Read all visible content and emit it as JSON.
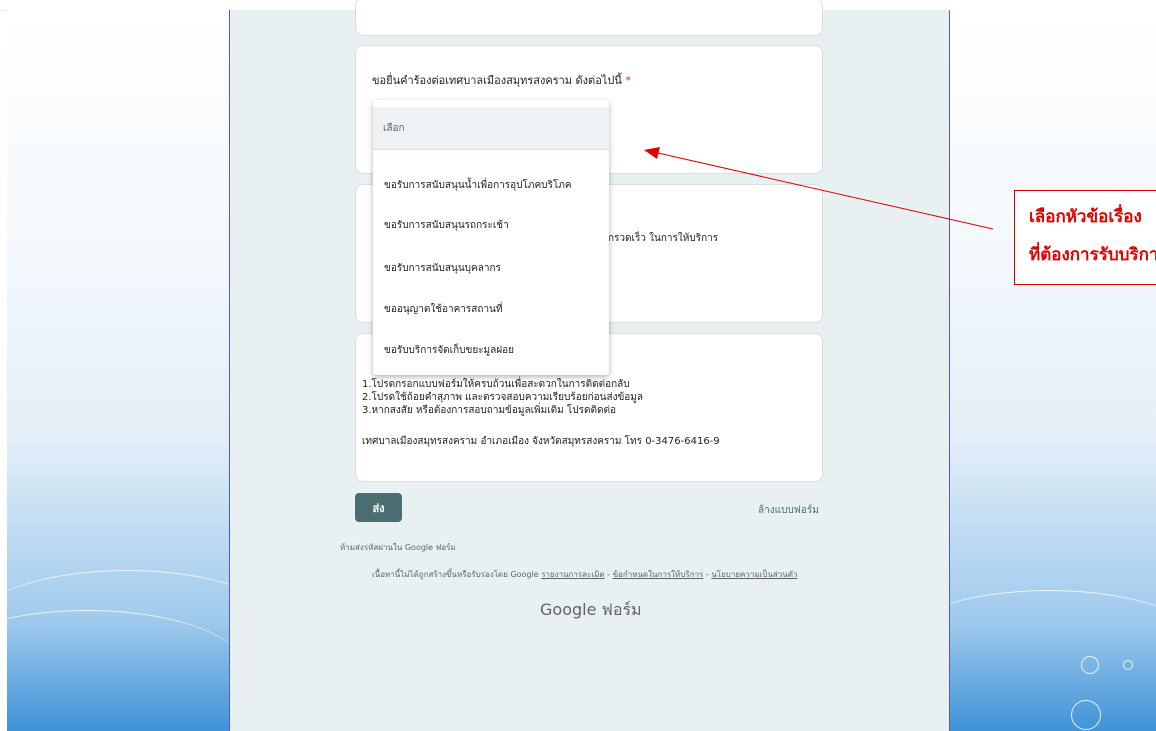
{
  "form": {
    "question_title": "ขอยื่นคำร้องต่อเทศบาลเมืองสมุทรสงคราม ดังต่อไปนี้",
    "required_mark": "*",
    "partial_description": "กรวดเร็ว ในการให้บริการ",
    "info_lines": [
      "1.โปรดกรอกแบบฟอร์มให้ครบถ้วนเพื่อสะดวกในการติดต่อกลับ",
      "2.โปรดใช้ถ้อยคำสุภาพ และตรวจสอบความเรียบร้อยก่อนส่งข้อมูล",
      "3.หากสงสัย หรือต้องการสอบถามข้อมูลเพิ่มเติม โปรดติดต่อ"
    ],
    "contact": "เทศบาลเมืองสมุทรสงคราม อำเภอเมือง จังหวัดสมุทรสงคราม โทร 0-3476-6416-9",
    "send_label": "ส่ง",
    "clear_label": "ล้างแบบฟอร์ม"
  },
  "dropdown": {
    "placeholder": "เลือก",
    "options": [
      "ขอรับการสนับสนุนน้ำเพื่อการอุปโภคบริโภค",
      "ขอรับการสนับสนุนรถกระเช้า",
      "ขอรับการสนับสนุนบุคลากร",
      "ขออนุญาตใช้อาคารสถานที่",
      "ขอรับบริการจัดเก็บขยะมูลฝอย"
    ]
  },
  "footer": {
    "never_password": "ห้ามส่งรหัสผ่านใน Google ฟอร์ม",
    "note": "เนื้อหานี้ไม่ได้ถูกสร้างขึ้นหรือรับรองโดย Google",
    "report_link": "รายงานการละเมิด",
    "terms_link": "ข้อกำหนดในการให้บริการ",
    "privacy_link": "นโยบายความเป็นส่วนตัว",
    "separator": " - ",
    "brand_google": "Google",
    "brand_forms": "ฟอร์ม"
  },
  "annotation": {
    "line1": "เลือกหัวข้อเรื่อง",
    "line2": "ที่ต้องการรับบริการ",
    "color": "#e00000"
  },
  "colors": {
    "accent": "#4a6d71",
    "required": "#d93025",
    "page_bg": "#e9f0f1"
  }
}
